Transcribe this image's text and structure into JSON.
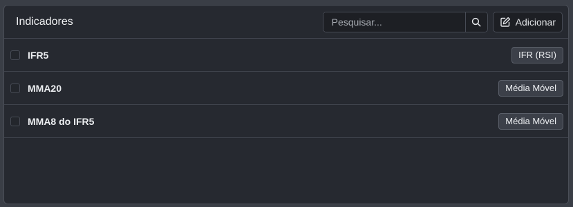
{
  "header": {
    "title": "Indicadores",
    "search": {
      "placeholder": "Pesquisar...",
      "value": "",
      "icon": "search-icon"
    },
    "add_label": "Adicionar",
    "add_icon": "edit-icon"
  },
  "indicators": [
    {
      "name": "IFR5",
      "type": "IFR (RSI)",
      "checked": false
    },
    {
      "name": "MMA20",
      "type": "Média Móvel",
      "checked": false
    },
    {
      "name": "MMA8 do IFR5",
      "type": "Média Móvel",
      "checked": false
    }
  ],
  "colors": {
    "background": "#262930",
    "border": "#474b55",
    "text": "#eceef1",
    "badge": "#3c4049"
  }
}
